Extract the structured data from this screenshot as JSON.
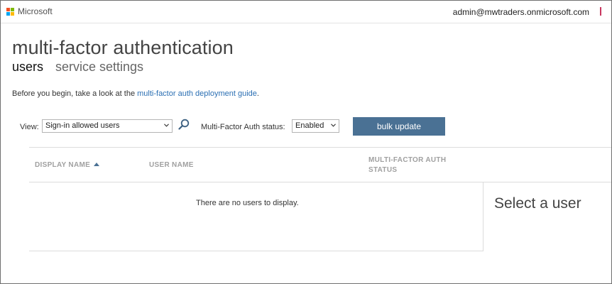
{
  "header": {
    "brand": "Microsoft",
    "account": "admin@mwtraders.onmicrosoft.com"
  },
  "page": {
    "title": "multi-factor authentication",
    "tabs": [
      {
        "label": "users",
        "active": true
      },
      {
        "label": "service settings",
        "active": false
      }
    ],
    "intro_prefix": "Before you begin, take a look at the ",
    "intro_link": "multi-factor auth deployment guide",
    "intro_suffix": "."
  },
  "filters": {
    "view_label": "View:",
    "view_value": "Sign-in allowed users",
    "status_label": "Multi-Factor Auth status:",
    "status_value": "Enabled",
    "bulk_update_label": "bulk update"
  },
  "table": {
    "columns": [
      "DISPLAY NAME",
      "USER NAME",
      "MULTI-FACTOR AUTH STATUS"
    ],
    "sorted_column": "DISPLAY NAME",
    "sort_direction": "ascending",
    "empty_message": "There are no users to display."
  },
  "detail_pane": {
    "title": "Select a user"
  },
  "colors": {
    "accent": "#4a7194",
    "link": "#2b6fb3",
    "ms_red": "#f25022",
    "ms_green": "#7fba00",
    "ms_blue": "#00a4ef",
    "ms_yellow": "#ffb900"
  }
}
